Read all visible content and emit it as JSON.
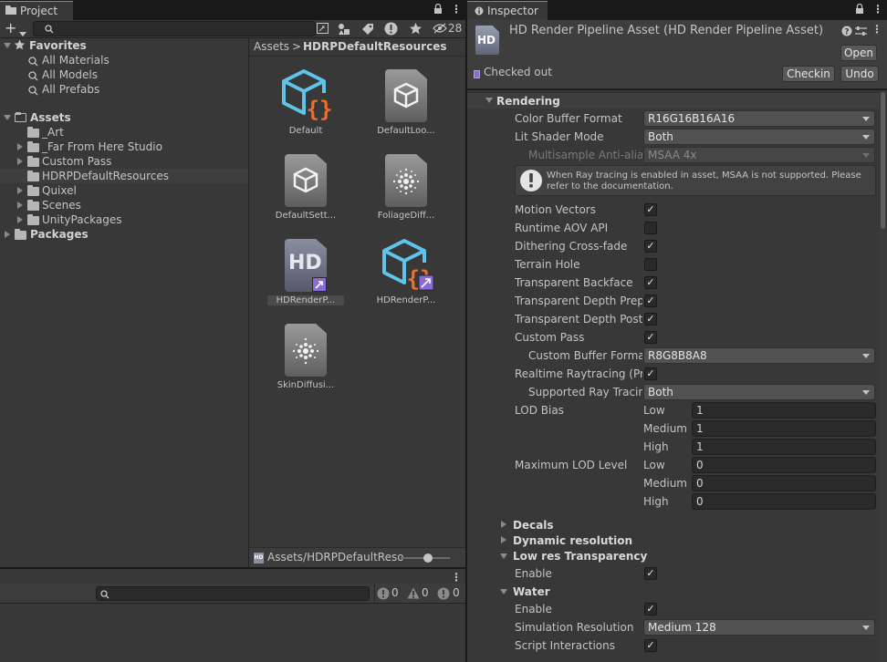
{
  "project": {
    "tab_label": "Project",
    "add_label": "+",
    "hidden_count": "28",
    "favorites": {
      "label": "Favorites",
      "items": [
        "All Materials",
        "All Models",
        "All Prefabs"
      ]
    },
    "assets": {
      "label": "Assets",
      "items": [
        "_Art",
        "_Far From Here Studio",
        "Custom Pass",
        "HDRPDefaultResources",
        "Quixel",
        "Scenes",
        "UnityPackages"
      ]
    },
    "packages_label": "Packages",
    "breadcrumb": {
      "root": "Assets",
      "separator": ">",
      "current": "HDRPDefaultResources"
    },
    "grid_items": [
      "Default",
      "DefaultLoo...",
      "DefaultSett...",
      "FoliageDiff...",
      "HDRenderP...",
      "HDRenderP...",
      "SkinDiffusi..."
    ],
    "hd_icon_text": "HD",
    "footer_path": "Assets/HDRPDefaultReso",
    "zoom_fraction": 0.55
  },
  "console": {
    "error_count": "0",
    "warning_count": "0",
    "info_count": "0"
  },
  "inspector": {
    "tab_label": "Inspector",
    "title": "HD Render Pipeline Asset (HD Render Pipeline Asset)",
    "header_icon_text": "HD",
    "open_label": "Open",
    "checked_out_label": "Checked out",
    "checkin_label": "Checkin",
    "undo_label": "Undo",
    "rendering_section": "Rendering",
    "color_buffer_format": {
      "label": "Color Buffer Format",
      "value": "R16G16B16A16"
    },
    "lit_shader_mode": {
      "label": "Lit Shader Mode",
      "value": "Both"
    },
    "msaa": {
      "label": "Multisample Anti-alias",
      "value": "MSAA 4x"
    },
    "warning_text": "When Ray tracing is enabled in asset, MSAA is not supported. Please refer to the documentation.",
    "checks": [
      {
        "label": "Motion Vectors",
        "checked": true
      },
      {
        "label": "Runtime AOV API",
        "checked": false
      },
      {
        "label": "Dithering Cross-fade",
        "checked": true
      },
      {
        "label": "Terrain Hole",
        "checked": false
      },
      {
        "label": "Transparent Backface",
        "checked": true
      },
      {
        "label": "Transparent Depth Prepa",
        "checked": true
      },
      {
        "label": "Transparent Depth Postp",
        "checked": true
      },
      {
        "label": "Custom Pass",
        "checked": true
      }
    ],
    "custom_buffer_format": {
      "label": "Custom Buffer Format",
      "value": "R8G8B8A8"
    },
    "realtime_raytracing": {
      "label": "Realtime Raytracing (Pre",
      "checked": true
    },
    "supported_ray_tracing": {
      "label": "Supported Ray Tracing",
      "value": "Both"
    },
    "lod_bias": {
      "label": "LOD Bias",
      "rows": [
        {
          "label": "Low",
          "value": "1"
        },
        {
          "label": "Medium",
          "value": "1"
        },
        {
          "label": "High",
          "value": "1"
        }
      ]
    },
    "max_lod": {
      "label": "Maximum LOD Level",
      "rows": [
        {
          "label": "Low",
          "value": "0"
        },
        {
          "label": "Medium",
          "value": "0"
        },
        {
          "label": "High",
          "value": "0"
        }
      ]
    },
    "decals_section": "Decals",
    "dynamic_resolution_section": "Dynamic resolution",
    "low_res_section": "Low res Transparency",
    "low_res_enable": {
      "label": "Enable",
      "checked": true
    },
    "water_section": "Water",
    "water_enable": {
      "label": "Enable",
      "checked": true
    },
    "simulation_resolution": {
      "label": "Simulation Resolution",
      "value": "Medium 128"
    },
    "script_interactions": {
      "label": "Script Interactions",
      "checked": true
    }
  },
  "colors": {
    "accent": "#5a8ee0",
    "panel": "#383838",
    "field": "#2a2a2a",
    "orange": "#f26c2b",
    "cyan": "#5fc4e8",
    "purple": "#8c6ad9"
  }
}
